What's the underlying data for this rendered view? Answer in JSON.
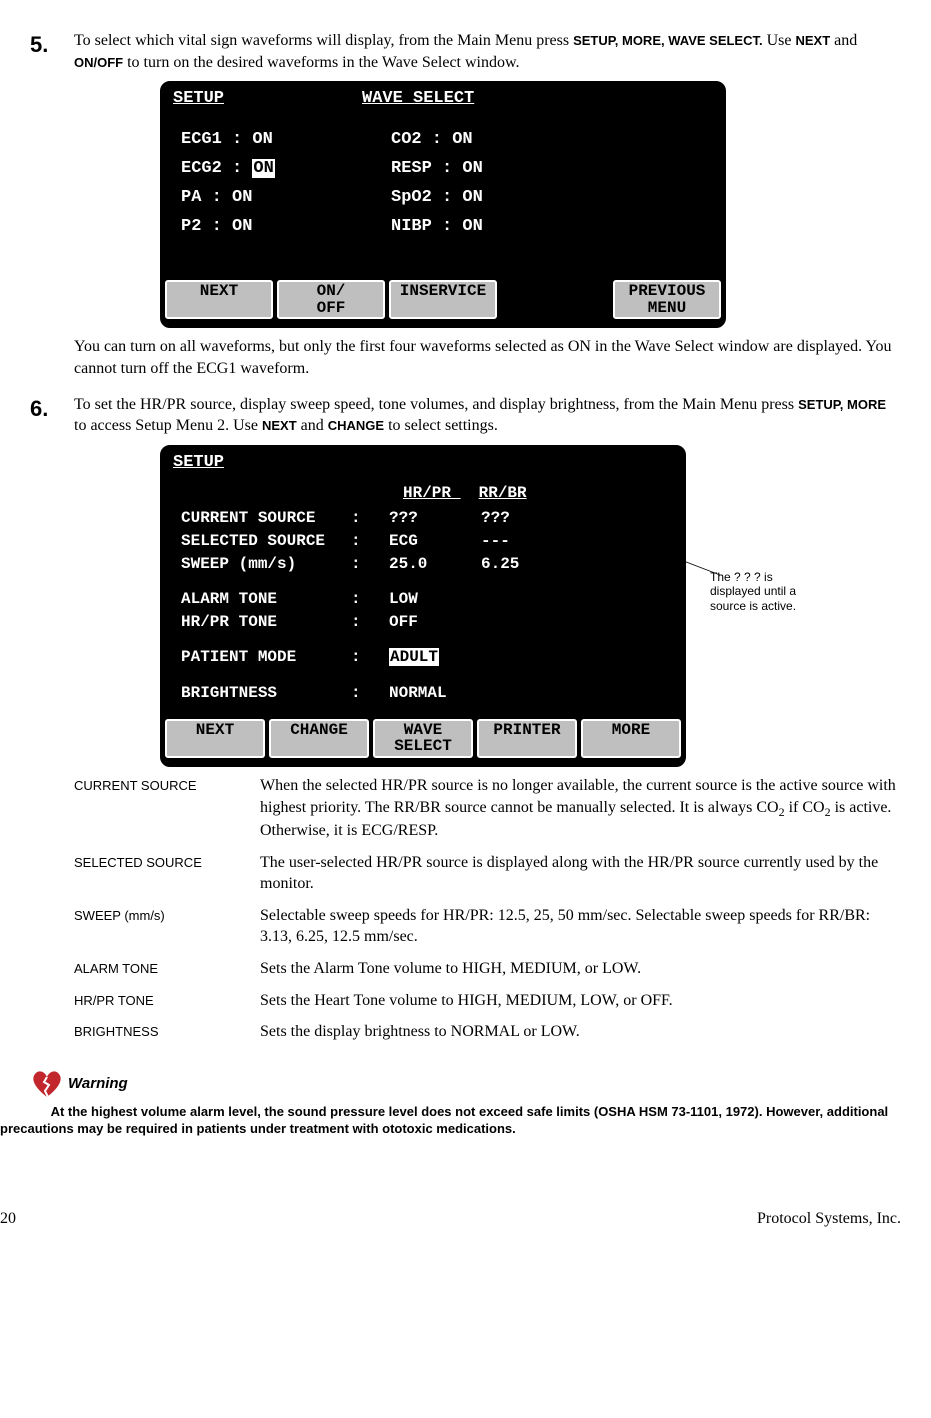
{
  "step5": {
    "num": "5.",
    "body_pre": "To select which vital sign waveforms will display, from the Main Menu press ",
    "k1": "SETUP",
    "k2": "MORE",
    "k3": "WAVE SELECT.",
    "body_mid": " Use ",
    "k4": "NEXT",
    "and": " and ",
    "k5": "ON/OFF",
    "body_post": " to turn on the desired waveforms in the Wave Select window."
  },
  "screen1": {
    "title1": "SETUP",
    "title2": "WAVE SELECT",
    "rows": [
      {
        "l": "ECG1  : ON",
        "r": "CO2  : ON"
      },
      {
        "l": "ECG2  : ",
        "l_inv": "ON",
        "r": "RESP : ON"
      },
      {
        "l": "PA    : ON",
        "r": "SpO2 : ON"
      },
      {
        "l": "P2    : ON",
        "r": "NIBP : ON"
      }
    ],
    "btns": [
      "NEXT",
      "ON/\nOFF",
      "INSERVICE",
      "",
      "PREVIOUS\nMENU"
    ]
  },
  "note5": "You can turn on all waveforms, but only the first four waveforms selected as ON in the Wave Select window are displayed. You cannot turn off the ECG1 waveform.",
  "step6": {
    "num": "6.",
    "body_pre": "To set the HR/PR source, display sweep speed, tone volumes, and display brightness, from the Main Menu press ",
    "k1": "SETUP",
    "k2": "MORE",
    "body_mid": " to access Setup Menu 2. Use ",
    "k3": "NEXT",
    "and": " and ",
    "k4": "CHANGE",
    "body_post": " to select settings."
  },
  "screen2": {
    "title": "SETUP",
    "colA": " HR/PR ",
    "colB": " RR/BR ",
    "rows1": [
      {
        "lbl": "CURRENT SOURCE",
        "c": ":",
        "v1": "???",
        "v2": "???"
      },
      {
        "lbl": "SELECTED SOURCE",
        "c": ":",
        "v1": "ECG",
        "v2": "---"
      },
      {
        "lbl": "SWEEP (mm/s)",
        "c": ":",
        "v1": "25.0",
        "v2": "6.25"
      }
    ],
    "rows2": [
      {
        "lbl": "ALARM TONE",
        "c": ":",
        "v1": "LOW"
      },
      {
        "lbl": "HR/PR TONE",
        "c": ":",
        "v1": "OFF"
      }
    ],
    "rows3": [
      {
        "lbl": "PATIENT MODE",
        "c": ":",
        "v1_inv": "ADULT"
      }
    ],
    "rows4": [
      {
        "lbl": "BRIGHTNESS",
        "c": ":",
        "v1": "NORMAL"
      }
    ],
    "btns": [
      "NEXT",
      "CHANGE",
      "WAVE\nSELECT",
      "PRINTER",
      "MORE"
    ]
  },
  "callout": "The ? ? ? is displayed until a source is active.",
  "defs": [
    {
      "term": "CURRENT SOURCE",
      "desc_pre": "When the selected HR/PR source is no longer available, the current source is the active source with highest priority. The RR/BR source cannot be manually selected. It is always CO",
      "sub1": "2",
      "desc_mid": " if CO",
      "sub2": "2",
      "desc_post": " is active. Otherwise, it is ECG/RESP."
    },
    {
      "term": "SELECTED SOURCE",
      "desc": "The user-selected HR/PR source is displayed along with the HR/PR source currently used by the monitor."
    },
    {
      "term": "SWEEP (mm/s)",
      "desc": "Selectable sweep speeds for HR/PR: 12.5, 25, 50 mm/sec. Selectable sweep speeds for RR/BR: 3.13, 6.25, 12.5 mm/sec."
    },
    {
      "term": "ALARM TONE",
      "desc": "Sets the Alarm Tone volume to HIGH, MEDIUM, or LOW."
    },
    {
      "term": "HR/PR TONE",
      "desc": "Sets the Heart Tone volume to HIGH, MEDIUM, LOW, or OFF."
    },
    {
      "term": "BRIGHTNESS",
      "desc": "Sets the display brightness to NORMAL or LOW."
    }
  ],
  "warning": {
    "label": "Warning",
    "text": "At the highest volume alarm level, the sound pressure level does not exceed safe limits (OSHA HSM 73-1101, 1972). However, additional precautions may be required in patients under treatment with ototoxic medications."
  },
  "footer": {
    "page": "20",
    "company": "Protocol Systems, Inc."
  }
}
